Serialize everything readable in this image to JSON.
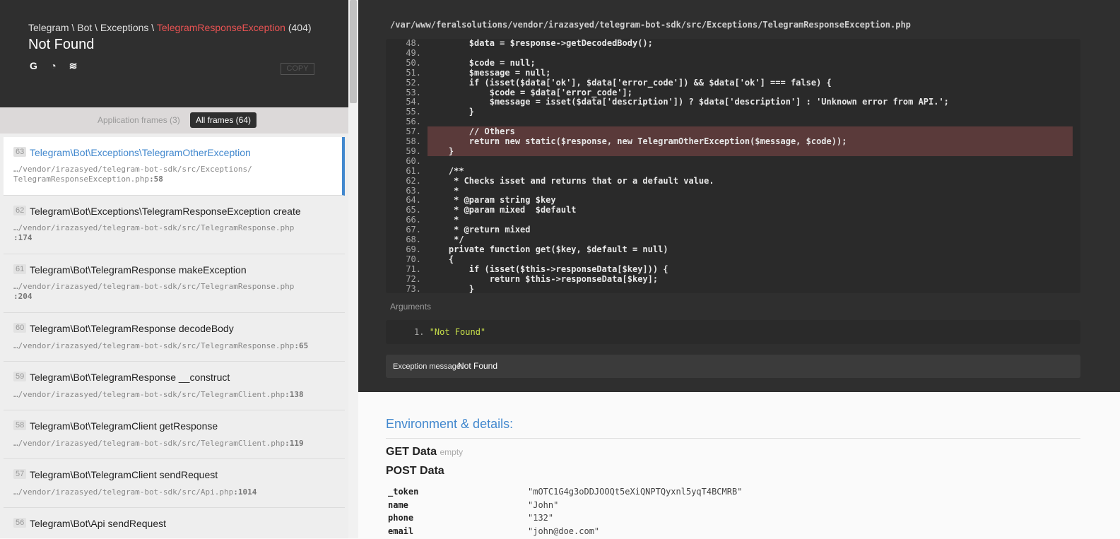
{
  "header": {
    "breadcrumb": "Telegram \\ Bot \\ Exceptions \\ ",
    "exception_class": "TelegramResponseException",
    "status_code": "(404)",
    "title": "Not Found",
    "copy_label": "COPY",
    "icons": [
      "google-search-icon",
      "duckduckgo-search-icon",
      "stackoverflow-search-icon"
    ]
  },
  "tabs": {
    "application": "Application frames (3)",
    "all": "All frames (64)"
  },
  "frames": [
    {
      "num": "63",
      "cls": "Telegram\\Bot\\Exceptions\\TelegramOtherException",
      "path1": "…/vendor/irazasyed/telegram-bot-sdk/src/Exceptions/",
      "path2": "TelegramResponseException.php",
      "line": ":58",
      "active": true
    },
    {
      "num": "62",
      "cls": "Telegram\\Bot\\Exceptions\\TelegramResponseException create",
      "path1": "…/vendor/irazasyed/telegram-bot-sdk/src/TelegramResponse.php",
      "path2": "",
      "line": ":174"
    },
    {
      "num": "61",
      "cls": "Telegram\\Bot\\TelegramResponse makeException",
      "path1": "…/vendor/irazasyed/telegram-bot-sdk/src/TelegramResponse.php",
      "path2": "",
      "line": ":204"
    },
    {
      "num": "60",
      "cls": "Telegram\\Bot\\TelegramResponse decodeBody",
      "path1": "…/vendor/irazasyed/telegram-bot-sdk/src/TelegramResponse.php",
      "path2": "",
      "line": ":65"
    },
    {
      "num": "59",
      "cls": "Telegram\\Bot\\TelegramResponse __construct",
      "path1": "…/vendor/irazasyed/telegram-bot-sdk/src/TelegramClient.php",
      "path2": "",
      "line": ":138"
    },
    {
      "num": "58",
      "cls": "Telegram\\Bot\\TelegramClient getResponse",
      "path1": "…/vendor/irazasyed/telegram-bot-sdk/src/TelegramClient.php",
      "path2": "",
      "line": ":119"
    },
    {
      "num": "57",
      "cls": "Telegram\\Bot\\TelegramClient sendRequest",
      "path1": "…/vendor/irazasyed/telegram-bot-sdk/src/Api.php",
      "path2": "",
      "line": ":1014"
    },
    {
      "num": "56",
      "cls": "Telegram\\Bot\\Api sendRequest",
      "path1": "",
      "path2": "",
      "line": ""
    }
  ],
  "code": {
    "file_path": "/var/www/feralsolutions/vendor/irazasyed/telegram-bot-sdk/src/Exceptions/TelegramResponseException.php",
    "highlighted_line": "58",
    "lines": [
      {
        "no": "48.",
        "text": "        $data = $response->getDecodedBody();"
      },
      {
        "no": "49.",
        "text": ""
      },
      {
        "no": "50.",
        "text": "        $code = null;"
      },
      {
        "no": "51.",
        "text": "        $message = null;"
      },
      {
        "no": "52.",
        "text": "        if (isset($data['ok'], $data['error_code']) && $data['ok'] === false) {"
      },
      {
        "no": "53.",
        "text": "            $code = $data['error_code'];"
      },
      {
        "no": "54.",
        "text": "            $message = isset($data['description']) ? $data['description'] : 'Unknown error from API.';"
      },
      {
        "no": "55.",
        "text": "        }"
      },
      {
        "no": "56.",
        "text": ""
      },
      {
        "no": "57.",
        "text": "        // Others"
      },
      {
        "no": "58.",
        "text": "        return new static($response, new TelegramOtherException($message, $code));"
      },
      {
        "no": "59.",
        "text": "    }"
      },
      {
        "no": "60.",
        "text": ""
      },
      {
        "no": "61.",
        "text": "    /**"
      },
      {
        "no": "62.",
        "text": "     * Checks isset and returns that or a default value."
      },
      {
        "no": "63.",
        "text": "     *"
      },
      {
        "no": "64.",
        "text": "     * @param string $key"
      },
      {
        "no": "65.",
        "text": "     * @param mixed  $default"
      },
      {
        "no": "66.",
        "text": "     *"
      },
      {
        "no": "67.",
        "text": "     * @return mixed"
      },
      {
        "no": "68.",
        "text": "     */"
      },
      {
        "no": "69.",
        "text": "    private function get($key, $default = null)"
      },
      {
        "no": "70.",
        "text": "    {"
      },
      {
        "no": "71.",
        "text": "        if (isset($this->responseData[$key])) {"
      },
      {
        "no": "72.",
        "text": "            return $this->responseData[$key];"
      },
      {
        "no": "73.",
        "text": "        }"
      }
    ]
  },
  "arguments": {
    "label": "Arguments",
    "items": [
      {
        "no": "1.",
        "value": "\"Not Found\""
      }
    ]
  },
  "exception_message": {
    "label": "Exception message:",
    "value": "Not Found"
  },
  "environment": {
    "title": "Environment & details:",
    "get_title": "GET Data",
    "get_empty": "empty",
    "post_title": "POST Data",
    "post": [
      {
        "key": "_token",
        "value": "\"mOTC1G4g3oDDJOOQt5eXiQNPTQyxnl5yqT4BCMRB\""
      },
      {
        "key": "name",
        "value": "\"John\""
      },
      {
        "key": "phone",
        "value": "\"132\""
      },
      {
        "key": "email",
        "value": "\"john@doe.com\""
      }
    ]
  },
  "colors": {
    "accent": "#4288ce",
    "exception_red": "#e95353",
    "panel_dark": "#2f2f2f",
    "highlight_line": "#5a3a3a"
  }
}
